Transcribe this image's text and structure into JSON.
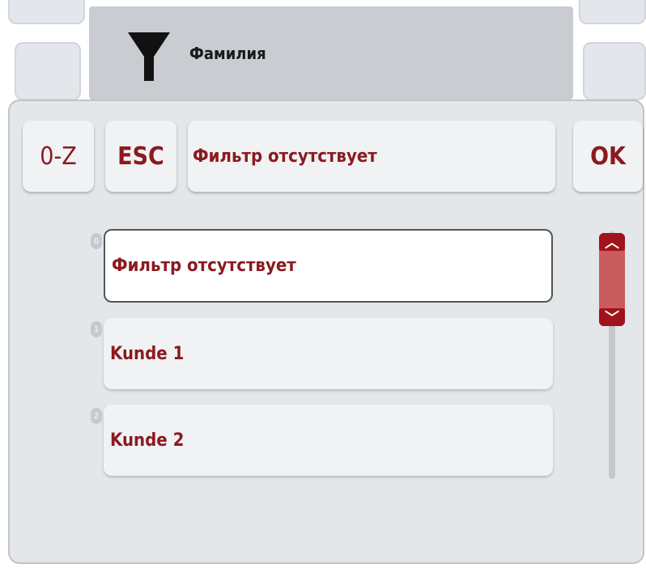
{
  "header": {
    "title": "Фамилия",
    "filter_icon": "filter-funnel-icon"
  },
  "toolbar": {
    "sort_label": "0-Z",
    "esc_label": "ESC",
    "current_filter": "Фильтр отсутствует",
    "ok_label": "OK"
  },
  "list": {
    "items": [
      {
        "index": "0",
        "label": "Фильтр отсутствует",
        "selected": true
      },
      {
        "index": "1",
        "label": "Kunde 1",
        "selected": false
      },
      {
        "index": "2",
        "label": "Kunde 2",
        "selected": false
      }
    ]
  },
  "scrollbar": {
    "up_glyph": "︿",
    "down_glyph": "﹀"
  },
  "colors": {
    "accent_text": "#8b1a1f",
    "scroll_accent": "#a1121a"
  }
}
